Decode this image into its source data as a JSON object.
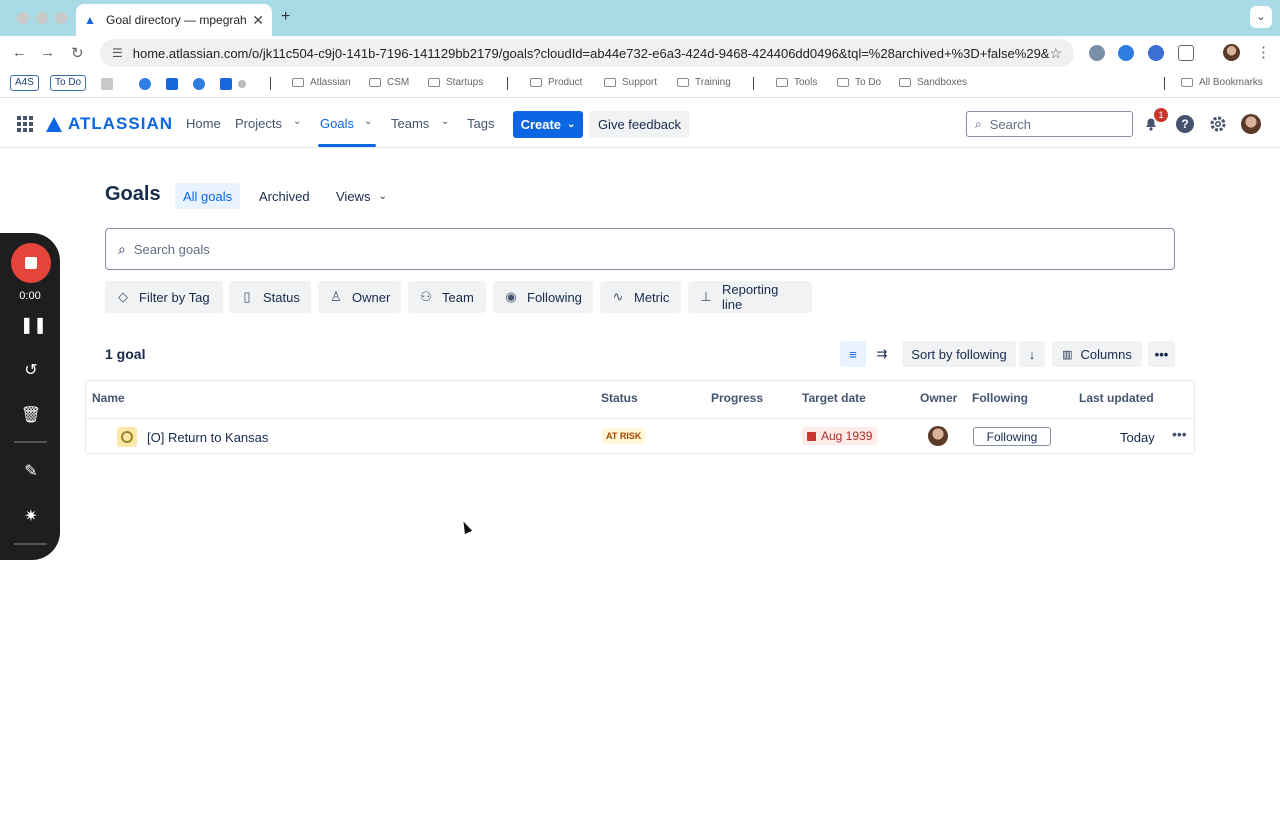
{
  "browser": {
    "tab_title": "Goal directory — mpegraham",
    "url": "home.atlassian.com/o/jk11c504-c9j0-141b-7196-141129bb2179/goals?cloudId=ab44e732-e6a3-424d-9468-424406dd0496&tql=%28archived+%3D+false%29&...",
    "bookmarks": {
      "chip1": "A4S",
      "chip2": "To Do",
      "folders": [
        "Atlassian",
        "CSM",
        "Startups",
        "Product",
        "Support",
        "Training",
        "Tools",
        "To Do",
        "Sandboxes"
      ],
      "all": "All Bookmarks"
    }
  },
  "topnav": {
    "logo": "ATLASSIAN",
    "home": "Home",
    "projects": "Projects",
    "goals": "Goals",
    "teams": "Teams",
    "tags": "Tags",
    "create": "Create",
    "feedback": "Give feedback",
    "search_placeholder": "Search",
    "notif_count": "1",
    "help": "?"
  },
  "recorder": {
    "time": "0:00"
  },
  "page": {
    "title": "Goals",
    "tabs": {
      "all": "All goals",
      "archived": "Archived",
      "views": "Views"
    },
    "search_placeholder": "Search goals",
    "filters": {
      "tag": "Filter by Tag",
      "status": "Status",
      "owner": "Owner",
      "team": "Team",
      "following": "Following",
      "metric": "Metric",
      "reporting": "Reporting line"
    },
    "count": "1 goal",
    "sort": "Sort by following",
    "columns": "Columns",
    "table": {
      "headers": {
        "name": "Name",
        "status": "Status",
        "progress": "Progress",
        "target": "Target date",
        "owner": "Owner",
        "following": "Following",
        "updated": "Last updated"
      },
      "rows": [
        {
          "name": "[O] Return to Kansas",
          "status": "AT RISK",
          "target": "Aug 1939",
          "following": "Following",
          "updated": "Today"
        }
      ]
    }
  }
}
